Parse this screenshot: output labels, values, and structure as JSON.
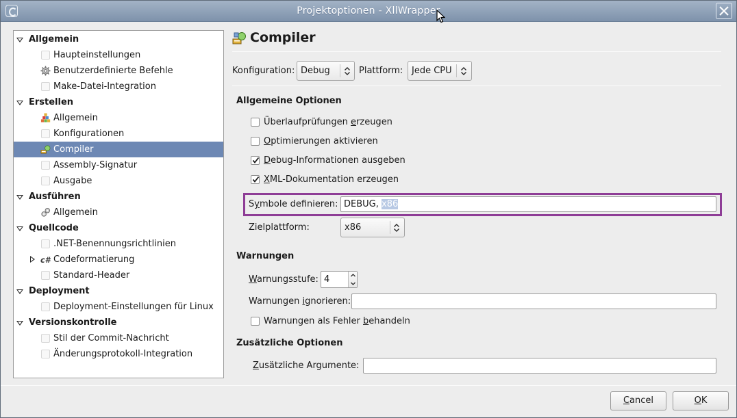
{
  "window": {
    "title": "Projektoptionen - XllWrapper"
  },
  "sidebar": {
    "categories": [
      {
        "label": "Allgemein",
        "items": [
          "Haupteinstellungen",
          "Benutzerdefinierte Befehle",
          "Make-Datei-Integration"
        ]
      },
      {
        "label": "Erstellen",
        "items": [
          "Allgemein",
          "Konfigurationen",
          "Compiler",
          "Assembly-Signatur",
          "Ausgabe"
        ]
      },
      {
        "label": "Ausführen",
        "items": [
          "Allgemein"
        ]
      },
      {
        "label": "Quellcode",
        "items": [
          ".NET-Benennungsrichtlinien",
          "Codeformatierung",
          "Standard-Header"
        ]
      },
      {
        "label": "Deployment",
        "items": [
          "Deployment-Einstellungen für Linux"
        ]
      },
      {
        "label": "Versionskontrolle",
        "items": [
          "Stil der Commit-Nachricht",
          "Änderungsprotokoll-Integration"
        ]
      }
    ],
    "selected": "Compiler"
  },
  "panel": {
    "title": "Compiler",
    "config_label": "Konfiguration:",
    "config_value": "Debug",
    "platform_label": "Plattform:",
    "platform_value": "Jede CPU"
  },
  "general": {
    "heading": "Allgemeine Optionen",
    "options": [
      {
        "pre": "Überlaufprüfungen ",
        "ul": "e",
        "post": "rzeugen",
        "checked": false
      },
      {
        "pre": "",
        "ul": "O",
        "post": "ptimierungen aktivieren",
        "checked": false
      },
      {
        "pre": "",
        "ul": "D",
        "post": "ebug-Informationen ausgeben",
        "checked": true
      },
      {
        "pre": "",
        "ul": "X",
        "post": "ML-Dokumentation erzeugen",
        "checked": true
      }
    ],
    "symbols_label_pre": "S",
    "symbols_label_ul": "y",
    "symbols_label_post": "mbole definieren:",
    "symbols_value_plain": "DEBUG, ",
    "symbols_value_selected": "x86",
    "target_label": "Zielplattform:",
    "target_value": "x86"
  },
  "warnings": {
    "heading": "Warnungen",
    "level_label_pre": "",
    "level_label_ul": "W",
    "level_label_post": "arnungsstufe:",
    "level_value": "4",
    "ignore_label_pre": "Warnungen ",
    "ignore_label_ul": "i",
    "ignore_label_post": "gnorieren:",
    "ignore_value": "",
    "as_errors_pre": "Warnungen als Fehler ",
    "as_errors_ul": "b",
    "as_errors_post": "ehandeln",
    "as_errors_checked": false
  },
  "extra": {
    "heading": "Zusätzliche Optionen",
    "args_label_pre": "",
    "args_label_ul": "Z",
    "args_label_post": "usätzliche Argumente:",
    "args_value": ""
  },
  "footer": {
    "cancel_ul": "C",
    "cancel_post": "ancel",
    "ok_ul": "O",
    "ok_post": "K"
  }
}
